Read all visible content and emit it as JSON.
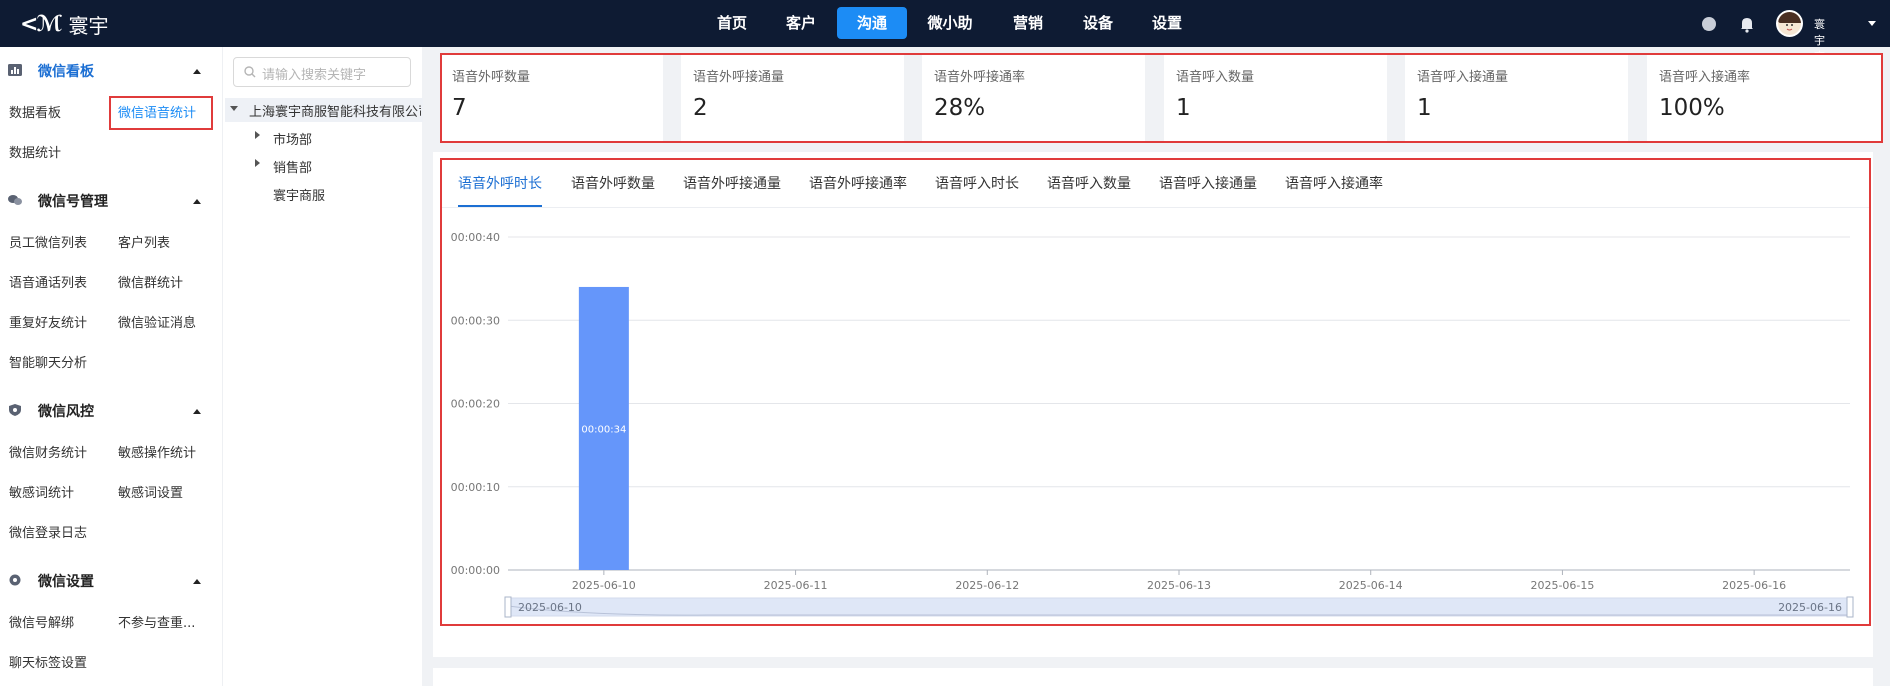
{
  "header": {
    "brand": "寰宇",
    "nav": [
      {
        "label": "首页",
        "active": false
      },
      {
        "label": "客户",
        "active": false
      },
      {
        "label": "沟通",
        "active": true
      },
      {
        "label": "微小助",
        "active": false
      },
      {
        "label": "营销",
        "active": false
      },
      {
        "label": "设备",
        "active": false
      },
      {
        "label": "设置",
        "active": false
      }
    ],
    "user_name": "寰宇商服",
    "accent": "#1c8cf5",
    "bg": "#0e1b33"
  },
  "sidebar": {
    "sections": [
      {
        "title": "微信看板",
        "icon": "bar-chart-icon",
        "items": [
          "数据看板",
          "微信语音统计",
          "数据统计"
        ],
        "active_item": "微信语音统计"
      },
      {
        "title": "微信号管理",
        "icon": "chat-icon",
        "items": [
          "员工微信列表",
          "客户列表",
          "语音通话列表",
          "微信群统计",
          "重复好友统计",
          "微信验证消息",
          "智能聊天分析"
        ]
      },
      {
        "title": "微信风控",
        "icon": "shield-icon",
        "items": [
          "微信财务统计",
          "敏感操作统计",
          "敏感词统计",
          "敏感词设置",
          "微信登录日志"
        ]
      },
      {
        "title": "微信设置",
        "icon": "gear-icon",
        "items": [
          "微信号解绑",
          "不参与查重...",
          "聊天标签设置"
        ]
      }
    ]
  },
  "tree": {
    "search_placeholder": "请输入搜索关键字",
    "root": "上海寰宇商服智能科技有限公司",
    "children": [
      "市场部",
      "销售部",
      "寰宇商服"
    ]
  },
  "stats": [
    {
      "label": "语音外呼数量",
      "value": "7"
    },
    {
      "label": "语音外呼接通量",
      "value": "2"
    },
    {
      "label": "语音外呼接通率",
      "value": "28%"
    },
    {
      "label": "语音呼入数量",
      "value": "1"
    },
    {
      "label": "语音呼入接通量",
      "value": "1"
    },
    {
      "label": "语音呼入接通率",
      "value": "100%"
    }
  ],
  "tabs": [
    "语音外呼时长",
    "语音外呼数量",
    "语音外呼接通量",
    "语音外呼接通率",
    "语音呼入时长",
    "语音呼入数量",
    "语音呼入接通量",
    "语音呼入接通率"
  ],
  "active_tab": "语音外呼时长",
  "chart_data": {
    "type": "bar",
    "categories": [
      "2025-06-10",
      "2025-06-11",
      "2025-06-12",
      "2025-06-13",
      "2025-06-14",
      "2025-06-15",
      "2025-06-16"
    ],
    "values": [
      34,
      0,
      0,
      0,
      0,
      0,
      0
    ],
    "value_labels": [
      "00:00:34",
      "",
      "",
      "",
      "",
      "",
      ""
    ],
    "y_ticks": [
      "00:00:00",
      "00:00:10",
      "00:00:20",
      "00:00:30",
      "00:00:40"
    ],
    "ylim": [
      0,
      40
    ],
    "bar_color": "#6596fa",
    "grid": true,
    "zoom_range_labels": [
      "2025-06-10",
      "2025-06-16"
    ]
  }
}
